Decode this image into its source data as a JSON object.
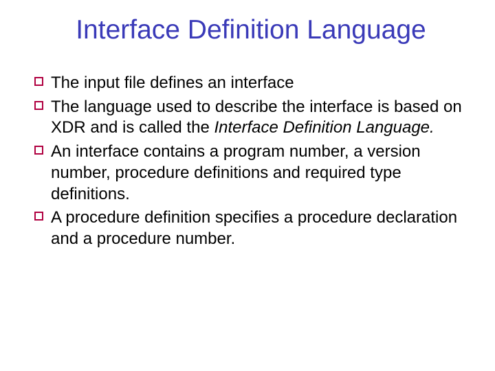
{
  "title": "Interface Definition Language",
  "bullets": [
    {
      "pre": "The input file defines an interface",
      "italic": "",
      "post": ""
    },
    {
      "pre": "The language used to describe the interface is based on XDR and is called the ",
      "italic": "Interface Definition Language.",
      "post": ""
    },
    {
      "pre": "An interface contains a program number, a version number, procedure definitions and required type definitions.",
      "italic": "",
      "post": ""
    },
    {
      "pre": "A procedure definition specifies a procedure declaration and a procedure number.",
      "italic": "",
      "post": ""
    }
  ]
}
